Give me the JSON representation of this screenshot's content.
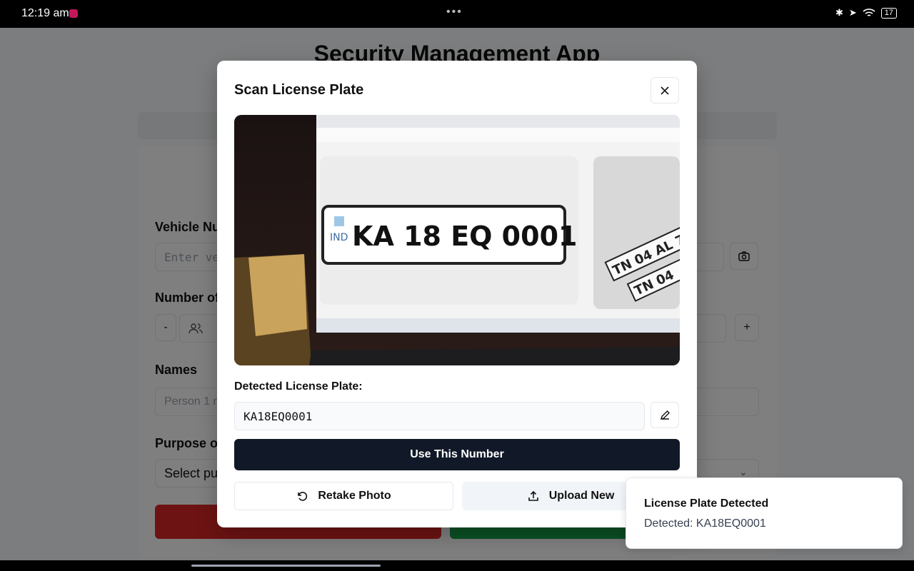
{
  "status_bar": {
    "time": "12:19 am",
    "battery": "17"
  },
  "app": {
    "title": "Security Management App",
    "form": {
      "vehicle_label": "Vehicle Nu",
      "vehicle_placeholder": "Enter ve",
      "number_label": "Number of",
      "minus": "-",
      "plus": "+",
      "names_label": "Names",
      "names_placeholder": "Person 1 n",
      "purpose_label": "Purpose of",
      "purpose_placeholder": "Select pu"
    }
  },
  "modal": {
    "title": "Scan License Plate",
    "photo": {
      "plate_country": "IND",
      "plate_text": "KA 18 EQ 0001",
      "side_plate_1": "TN 04 AL 7",
      "side_plate_2": "TN 04"
    },
    "detected_label": "Detected License Plate:",
    "detected_value": "KA18EQ0001",
    "use_button": "Use This Number",
    "retake_button": "Retake Photo",
    "upload_button": "Upload New"
  },
  "toast": {
    "title": "License Plate Detected",
    "description": "Detected: KA18EQ0001"
  },
  "colors": {
    "primary": "#111827",
    "danger": "#dc2626",
    "success": "#16a34a"
  }
}
